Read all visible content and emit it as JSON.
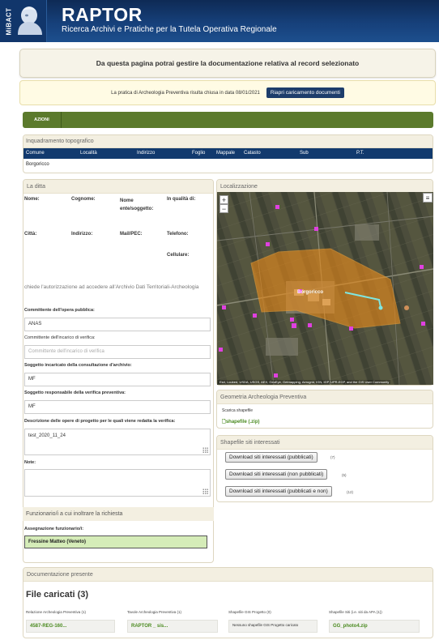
{
  "header": {
    "logo_text": "MiBACT",
    "title": "RAPTOR",
    "subtitle": "Ricerca Archivi e Pratiche per la Tutela Operativa Regionale",
    "bg_color": "#16407a"
  },
  "banner": {
    "text": "Da questa pagina potrai gestire la documentazione relativa al record selezionato"
  },
  "notice": {
    "text": "La pratica di Archeologia Preventiva risulta chiusa in data 08/01/2021",
    "button": "Riapri caricamento documenti"
  },
  "azioni": {
    "label": "AZIONI",
    "color": "#5b7a2c"
  },
  "inquadramento": {
    "title": "Inquadramento topografico",
    "columns": [
      "Comune",
      "Località",
      "Indirizzo",
      "Foglio",
      "Mappale",
      "Catasto",
      "Sub",
      "P.T."
    ],
    "rows": [
      [
        "Borgoricco",
        "",
        "",
        "",
        "",
        "",
        "",
        ""
      ]
    ]
  },
  "ditta": {
    "title": "La ditta",
    "fields": {
      "nome": "Nome:",
      "cognome": "Cognome:",
      "nome_ente": "Nome ente/soggetto:",
      "qualita": "In qualità di:",
      "citta": "Città:",
      "indirizzo": "Indirizzo:",
      "mail": "Mail/PEC:",
      "telefono": "Telefono:",
      "cellulare": "Cellulare:"
    },
    "request_note": "chiede l'autorizzazione ad accedere all'Archivio Dati Territoriali-Archeologia",
    "committente_opera_label": "Committente dell'opera pubblica:",
    "committente_opera_value": "ANAS",
    "committente_incarico_label": "Committente dell'incarico di verifica:",
    "committente_incarico_placeholder": "Committente dell'incarico di verifica",
    "soggetto_consultazione_label": "Soggetto incaricato della consultazione d'archivio:",
    "soggetto_consultazione_value": "MF",
    "soggetto_verifica_label": "Soggetto responsabile della verifica preventiva:",
    "soggetto_verifica_value": "MF",
    "descrizione_label": "Descrizione delle opere di progetto per le quali viene redatta la verifica:",
    "descrizione_value": "test_2020_11_24",
    "note_label": "Note:",
    "note_value": ""
  },
  "funzionari": {
    "title": "Funzionario/i a cui inoltrare la richiesta",
    "assegnazione_label": "Assegnazione funzionario/i:",
    "assegnazione_value": "Fressine Matteo (Veneto)"
  },
  "localizzazione": {
    "title": "Localizzazione",
    "zoom_in": "+",
    "zoom_out": "−",
    "menu_icon": "≡",
    "place_label": "Borgoricco",
    "attribution": "Esri, i-cubed, USDA, USGS, AEX, GeoEye, Getmapping, Aerogrid, IGN, IGP, UPR-EGP, and the GIS User Community",
    "polygon_color": "#e88a1a"
  },
  "geometria": {
    "title": "Geometria Archeologia Preventiva",
    "scarica_label": "Scarica shapefile",
    "link": "shapefile (.zip)"
  },
  "shapefile": {
    "title": "Shapefile siti interessati",
    "buttons": [
      {
        "label": "Download siti interessati (pubblicati)",
        "count": "(7)"
      },
      {
        "label": "Download siti interessati (non pubblicati)",
        "count": "(5)"
      },
      {
        "label": "Download siti interessati (pubblicati e non)",
        "count": "(12)"
      }
    ]
  },
  "documentazione": {
    "title": "Documentazione presente",
    "file_title": "File caricati (3)",
    "columns": [
      {
        "label": "Relazione Archeologia Preventiva (1)",
        "value": "4587-REG-160..."
      },
      {
        "label": "Tavole Archeologia Preventiva (1)",
        "value": "RAPTOR _ sis..."
      },
      {
        "label": "Shapefile GIS Progetto (0)",
        "value": "Nessuno shapefile GIS Progetto caricato"
      },
      {
        "label": "Shapefile Siti (i.e. siti da APA (1))",
        "value": "GG_photo4.zip"
      }
    ]
  }
}
